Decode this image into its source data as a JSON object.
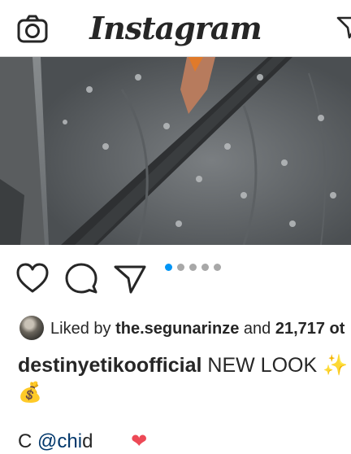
{
  "header": {
    "logo_text": "Instagram",
    "camera_icon": "camera-icon",
    "direct_icon": "paper-plane-icon"
  },
  "post": {
    "carousel": {
      "total": 5,
      "active_index": 0
    },
    "actions": {
      "like_icon": "heart-outline-icon",
      "comment_icon": "comment-bubble-icon",
      "share_icon": "paper-plane-icon"
    },
    "likes": {
      "prefix": "Liked by",
      "user": "the.segunarinze",
      "joiner": "and",
      "others": "21,717 ot"
    },
    "caption": {
      "username": "destinyetikoofficial",
      "text": "NEW LOOK ✨",
      "line2": "💰"
    },
    "next_comment": {
      "prefix": "C",
      "mention": "@chi",
      "rest": "d",
      "emoji": "❤"
    }
  },
  "colors": {
    "accent": "#0095f6",
    "text": "#262626",
    "divider": "#dbdbdb",
    "inactive_dot": "#a8a8a8"
  }
}
